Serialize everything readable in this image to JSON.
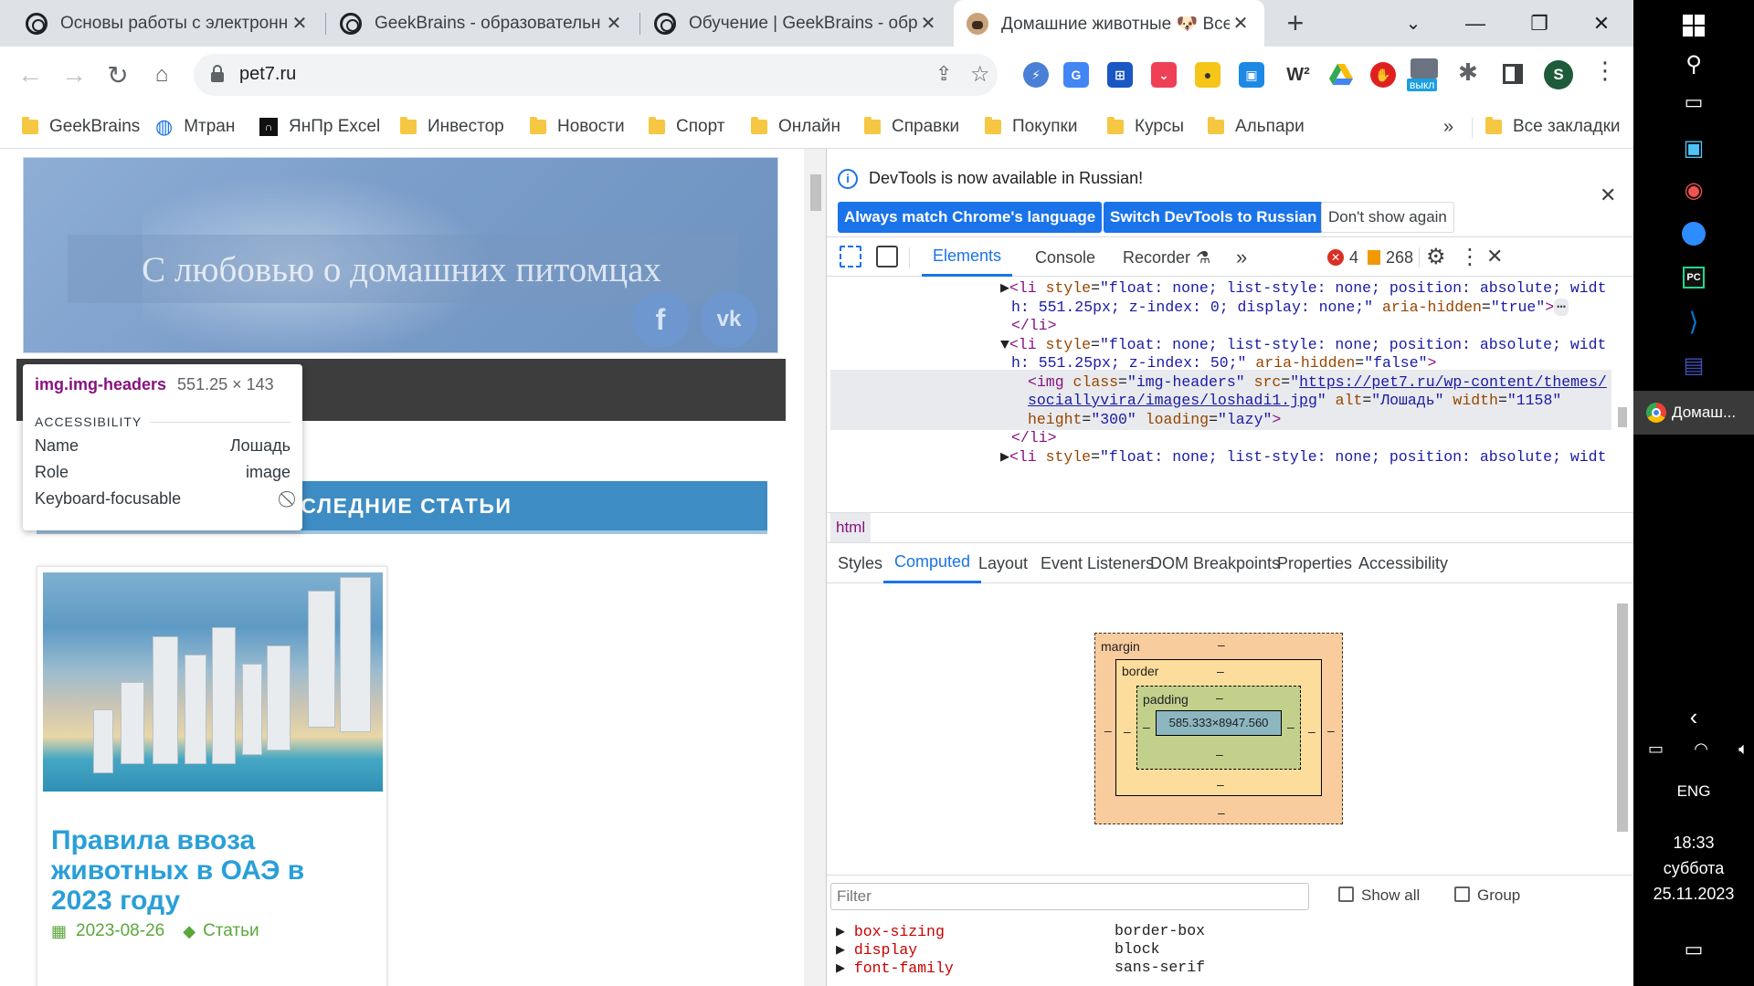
{
  "tabs": [
    {
      "title": "Основы работы с электронн",
      "icon": "circle-icon"
    },
    {
      "title": "GeekBrains - образовательн",
      "icon": "circle-icon"
    },
    {
      "title": "Обучение | GeekBrains - обр",
      "icon": "circle-icon"
    },
    {
      "title": "Домашние животные 🐶 Все",
      "icon": "pug-icon",
      "active": true
    }
  ],
  "address": {
    "url": "pet7.ru"
  },
  "extensions": {
    "w2_label": "W²",
    "off_badge": "выкл",
    "profile_letter": "S"
  },
  "bookmarks": [
    "GeekBrains",
    "Мтран",
    "ЯнПр Excel",
    "Инвестор",
    "Новости",
    "Спорт",
    "Онлайн",
    "Справки",
    "Покупки",
    "Курсы",
    "Альпари"
  ],
  "bookmarks_overflow": "»",
  "bookmarks_all": "Все закладки",
  "page": {
    "banner_title": "С любовью о домашних питомцах",
    "social": [
      "f",
      "vk"
    ],
    "latest_heading": "ПОСЛЕДНИЕ СТАТЬИ",
    "latest_heading_visible": "ОСЛЕДНИЕ СТАТЬИ",
    "card": {
      "title": "Правила ввоза животных в ОАЭ в 2023 году",
      "date": "2023-08-26",
      "category": "Статьи"
    }
  },
  "tooltip": {
    "selector": "img.img-headers",
    "dimensions": "551.25 × 143",
    "section": "ACCESSIBILITY",
    "rows": [
      {
        "label": "Name",
        "value": "Лошадь"
      },
      {
        "label": "Role",
        "value": "image"
      },
      {
        "label": "Keyboard-focusable",
        "value": ""
      }
    ]
  },
  "devtools": {
    "info_text": "DevTools is now available in Russian!",
    "buttons": [
      "Always match Chrome's language",
      "Switch DevTools to Russian",
      "Don't show again"
    ],
    "tabs": [
      "Elements",
      "Console",
      "Recorder",
      "»"
    ],
    "active_tab": "Elements",
    "errors": "4",
    "warnings": "268",
    "breadcrumb": "html",
    "subtabs": [
      "Styles",
      "Computed",
      "Layout",
      "Event Listeners",
      "DOM Breakpoints",
      "Properties",
      "Accessibility"
    ],
    "active_subtab": "Computed",
    "box_model": {
      "margin_label": "margin",
      "border_label": "border",
      "padding_label": "padding",
      "content": "585.333×8947.560",
      "dash": "–"
    },
    "filter_placeholder": "Filter",
    "show_all": "Show all",
    "group": "Group",
    "computed": [
      {
        "name": "box-sizing",
        "value": "border-box"
      },
      {
        "name": "display",
        "value": "block"
      },
      {
        "name": "font-family",
        "value": "sans-serif"
      }
    ]
  },
  "taskbar": {
    "app_label": "Домаш...",
    "lang": "ENG",
    "time": "18:33",
    "day": "суббота",
    "date": "25.11.2023"
  }
}
